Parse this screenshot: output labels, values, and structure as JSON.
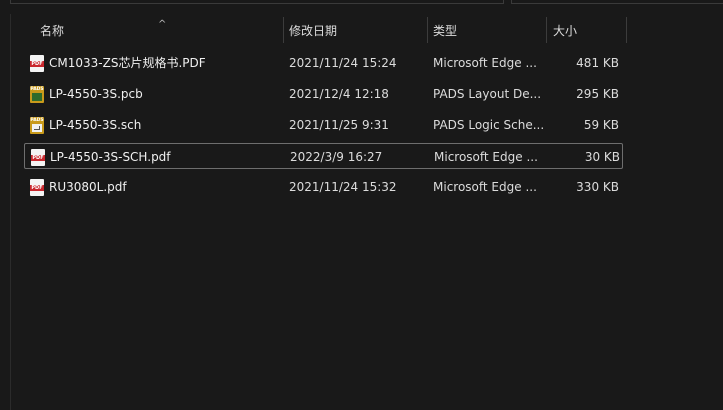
{
  "header": {
    "name": "名称",
    "date": "修改日期",
    "type": "类型",
    "size": "大小"
  },
  "files": [
    {
      "name": "CM1033-ZS芯片规格书.PDF",
      "date": "2021/11/24 15:24",
      "type": "Microsoft Edge ...",
      "size": "481 KB",
      "icon": "pdf-icon",
      "icon_text": "PDF"
    },
    {
      "name": "LP-4550-3S.pcb",
      "date": "2021/12/4 12:18",
      "type": "PADS Layout De...",
      "size": "295 KB",
      "icon": "pads-pcb-icon",
      "icon_text": "PADS"
    },
    {
      "name": "LP-4550-3S.sch",
      "date": "2021/11/25 9:31",
      "type": "PADS Logic Sche...",
      "size": "59 KB",
      "icon": "pads-sch-icon",
      "icon_text": "PADS"
    },
    {
      "name": "LP-4550-3S-SCH.pdf",
      "date": "2022/3/9 16:27",
      "type": "Microsoft Edge ...",
      "size": "30 KB",
      "icon": "pdf-icon",
      "icon_text": "PDF"
    },
    {
      "name": "RU3080L.pdf",
      "date": "2021/11/24 15:32",
      "type": "Microsoft Edge ...",
      "size": "330 KB",
      "icon": "pdf-icon",
      "icon_text": "PDF"
    }
  ],
  "focused_row": 3
}
